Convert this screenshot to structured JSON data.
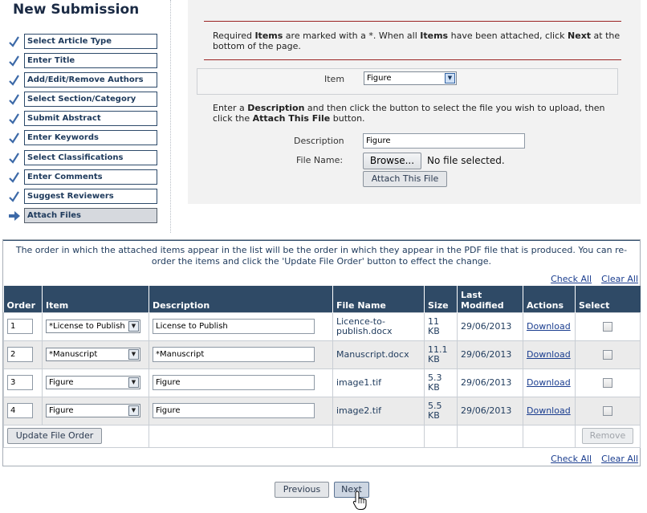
{
  "sidebar": {
    "title": "New Submission",
    "steps": [
      {
        "label": "Select Article Type",
        "done": true
      },
      {
        "label": "Enter Title",
        "done": true
      },
      {
        "label": "Add/Edit/Remove Authors",
        "done": true
      },
      {
        "label": "Select Section/Category",
        "done": true
      },
      {
        "label": "Submit Abstract",
        "done": true
      },
      {
        "label": "Enter Keywords",
        "done": true
      },
      {
        "label": "Select Classifications",
        "done": true
      },
      {
        "label": "Enter Comments",
        "done": true
      },
      {
        "label": "Suggest Reviewers",
        "done": true
      },
      {
        "label": "Attach Files",
        "current": true
      }
    ]
  },
  "upload": {
    "required_note": {
      "p1": "Required ",
      "b1": "Items",
      "p2": " are marked with a *. When all ",
      "b2": "Items",
      "p3": " have been attached, click ",
      "b3": "Next",
      "p4": " at the bottom of the page."
    },
    "item_label": "Item",
    "item_value": "Figure",
    "instructions": {
      "p1": "Enter a ",
      "b1": "Description",
      "p2": " and then click the button to select the file you wish to upload, then click the ",
      "b2": "Attach This File",
      "p3": " button."
    },
    "description_label": "Description",
    "description_value": "Figure",
    "filename_label": "File Name:",
    "browse_label": "Browse...",
    "no_file_text": "No file selected.",
    "attach_button": "Attach This File"
  },
  "files": {
    "order_note": "The order in which the attached items appear in the list will be the order in which they appear in the PDF file that is produced. You can re-order the items and click the 'Update File Order' button to effect the change.",
    "check_all": "Check All",
    "clear_all": "Clear All",
    "columns": {
      "order": "Order",
      "item": "Item",
      "description": "Description",
      "file_name": "File Name",
      "size": "Size",
      "last_modified": "Last Modified",
      "actions": "Actions",
      "select": "Select"
    },
    "rows": [
      {
        "order": "1",
        "item": "*License to Publish",
        "description": "License to Publish",
        "file_name": "Licence-to-publish.docx",
        "size": "11 KB",
        "last_modified": "29/06/2013",
        "action": "Download"
      },
      {
        "order": "2",
        "item": "*Manuscript",
        "description": "*Manuscript",
        "file_name": "Manuscript.docx",
        "size": "11.1 KB",
        "last_modified": "29/06/2013",
        "action": "Download"
      },
      {
        "order": "3",
        "item": "Figure",
        "description": "Figure",
        "file_name": "image1.tif",
        "size": "5.3 KB",
        "last_modified": "29/06/2013",
        "action": "Download"
      },
      {
        "order": "4",
        "item": "Figure",
        "description": "Figure",
        "file_name": "image2.tif",
        "size": "5.5 KB",
        "last_modified": "29/06/2013",
        "action": "Download"
      }
    ],
    "update_button": "Update File Order",
    "remove_button": "Remove"
  },
  "nav": {
    "previous": "Previous",
    "next": "Next"
  },
  "colors": {
    "header_bg": "#2f4a66",
    "panel_bg": "#f2f2f2",
    "rule_red": "#9b2222",
    "check_blue": "#3d6aa8",
    "link_blue": "#1a3d8f"
  }
}
